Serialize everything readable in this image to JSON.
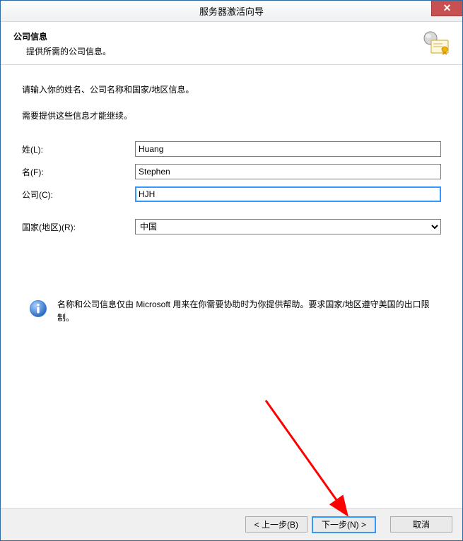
{
  "window": {
    "title": "服务器激活向导"
  },
  "header": {
    "title": "公司信息",
    "subtitle": "提供所需的公司信息。"
  },
  "body": {
    "instruction1": "请输入你的姓名、公司名称和国家/地区信息。",
    "instruction2": "需要提供这些信息才能继续。",
    "fields": {
      "lastname_label": "姓(L):",
      "lastname_value": "Huang",
      "firstname_label": "名(F):",
      "firstname_value": "Stephen",
      "company_label": "公司(C):",
      "company_value": "HJH",
      "country_label": "国家(地区)(R):",
      "country_value": "中国"
    },
    "info_text": "名称和公司信息仅由 Microsoft 用来在你需要协助时为你提供帮助。要求国家/地区遵守美国的出口限制。"
  },
  "footer": {
    "back": "< 上一步(B)",
    "next": "下一步(N) >",
    "cancel": "取消"
  }
}
